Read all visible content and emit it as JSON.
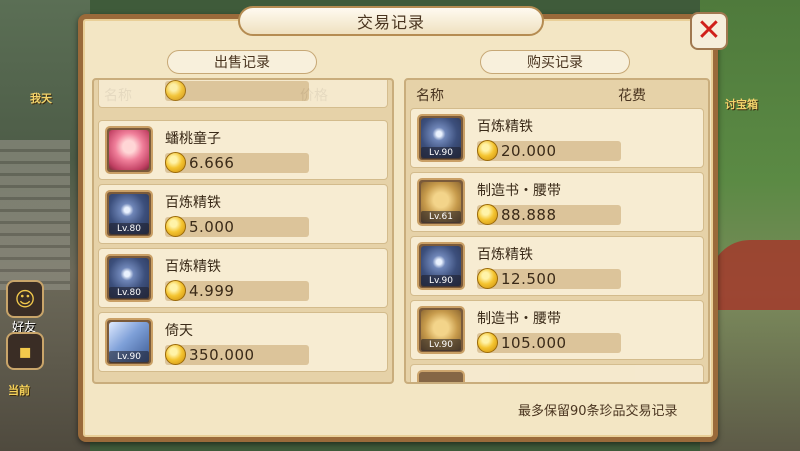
{
  "dialog": {
    "title": "交易记录",
    "close_symbol": "✕",
    "footer_note": "最多保留90条珍品交易记录"
  },
  "sell": {
    "header": "出售记录",
    "col_name": "名称",
    "col_price": "价格",
    "items": [
      {
        "name": "蟠桃童子",
        "price": "6.666",
        "level": "",
        "icon": "peach-child-icon"
      },
      {
        "name": "百炼精铁",
        "price": "5.000",
        "level": "Lv.80",
        "icon": "refined-iron-icon"
      },
      {
        "name": "百炼精铁",
        "price": "4.999",
        "level": "Lv.80",
        "icon": "refined-iron-icon"
      },
      {
        "name": "倚天",
        "price": "350.000",
        "level": "Lv.90",
        "icon": "sword-icon"
      }
    ]
  },
  "buy": {
    "header": "购买记录",
    "col_name": "名称",
    "col_price": "花费",
    "items": [
      {
        "name": "百炼精铁",
        "price": "20.000",
        "level": "Lv.90",
        "icon": "refined-iron-icon"
      },
      {
        "name": "制造书・腰带",
        "price": "88.888",
        "level": "Lv.61",
        "icon": "craft-book-icon"
      },
      {
        "name": "百炼精铁",
        "price": "12.500",
        "level": "Lv.90",
        "icon": "refined-iron-icon"
      },
      {
        "name": "制造书・腰带",
        "price": "105.000",
        "level": "Lv.90",
        "icon": "craft-book-icon"
      }
    ]
  },
  "hud": {
    "friends_label": "好友",
    "left_text_1": "我天",
    "left_text_2": "当前",
    "right_text": "讨宝箱"
  },
  "colors": {
    "panel_bg": "#f3e6c4",
    "panel_border": "#9a6a3a",
    "close_red": "#d0201a",
    "coin_gold": "#f4c430"
  }
}
